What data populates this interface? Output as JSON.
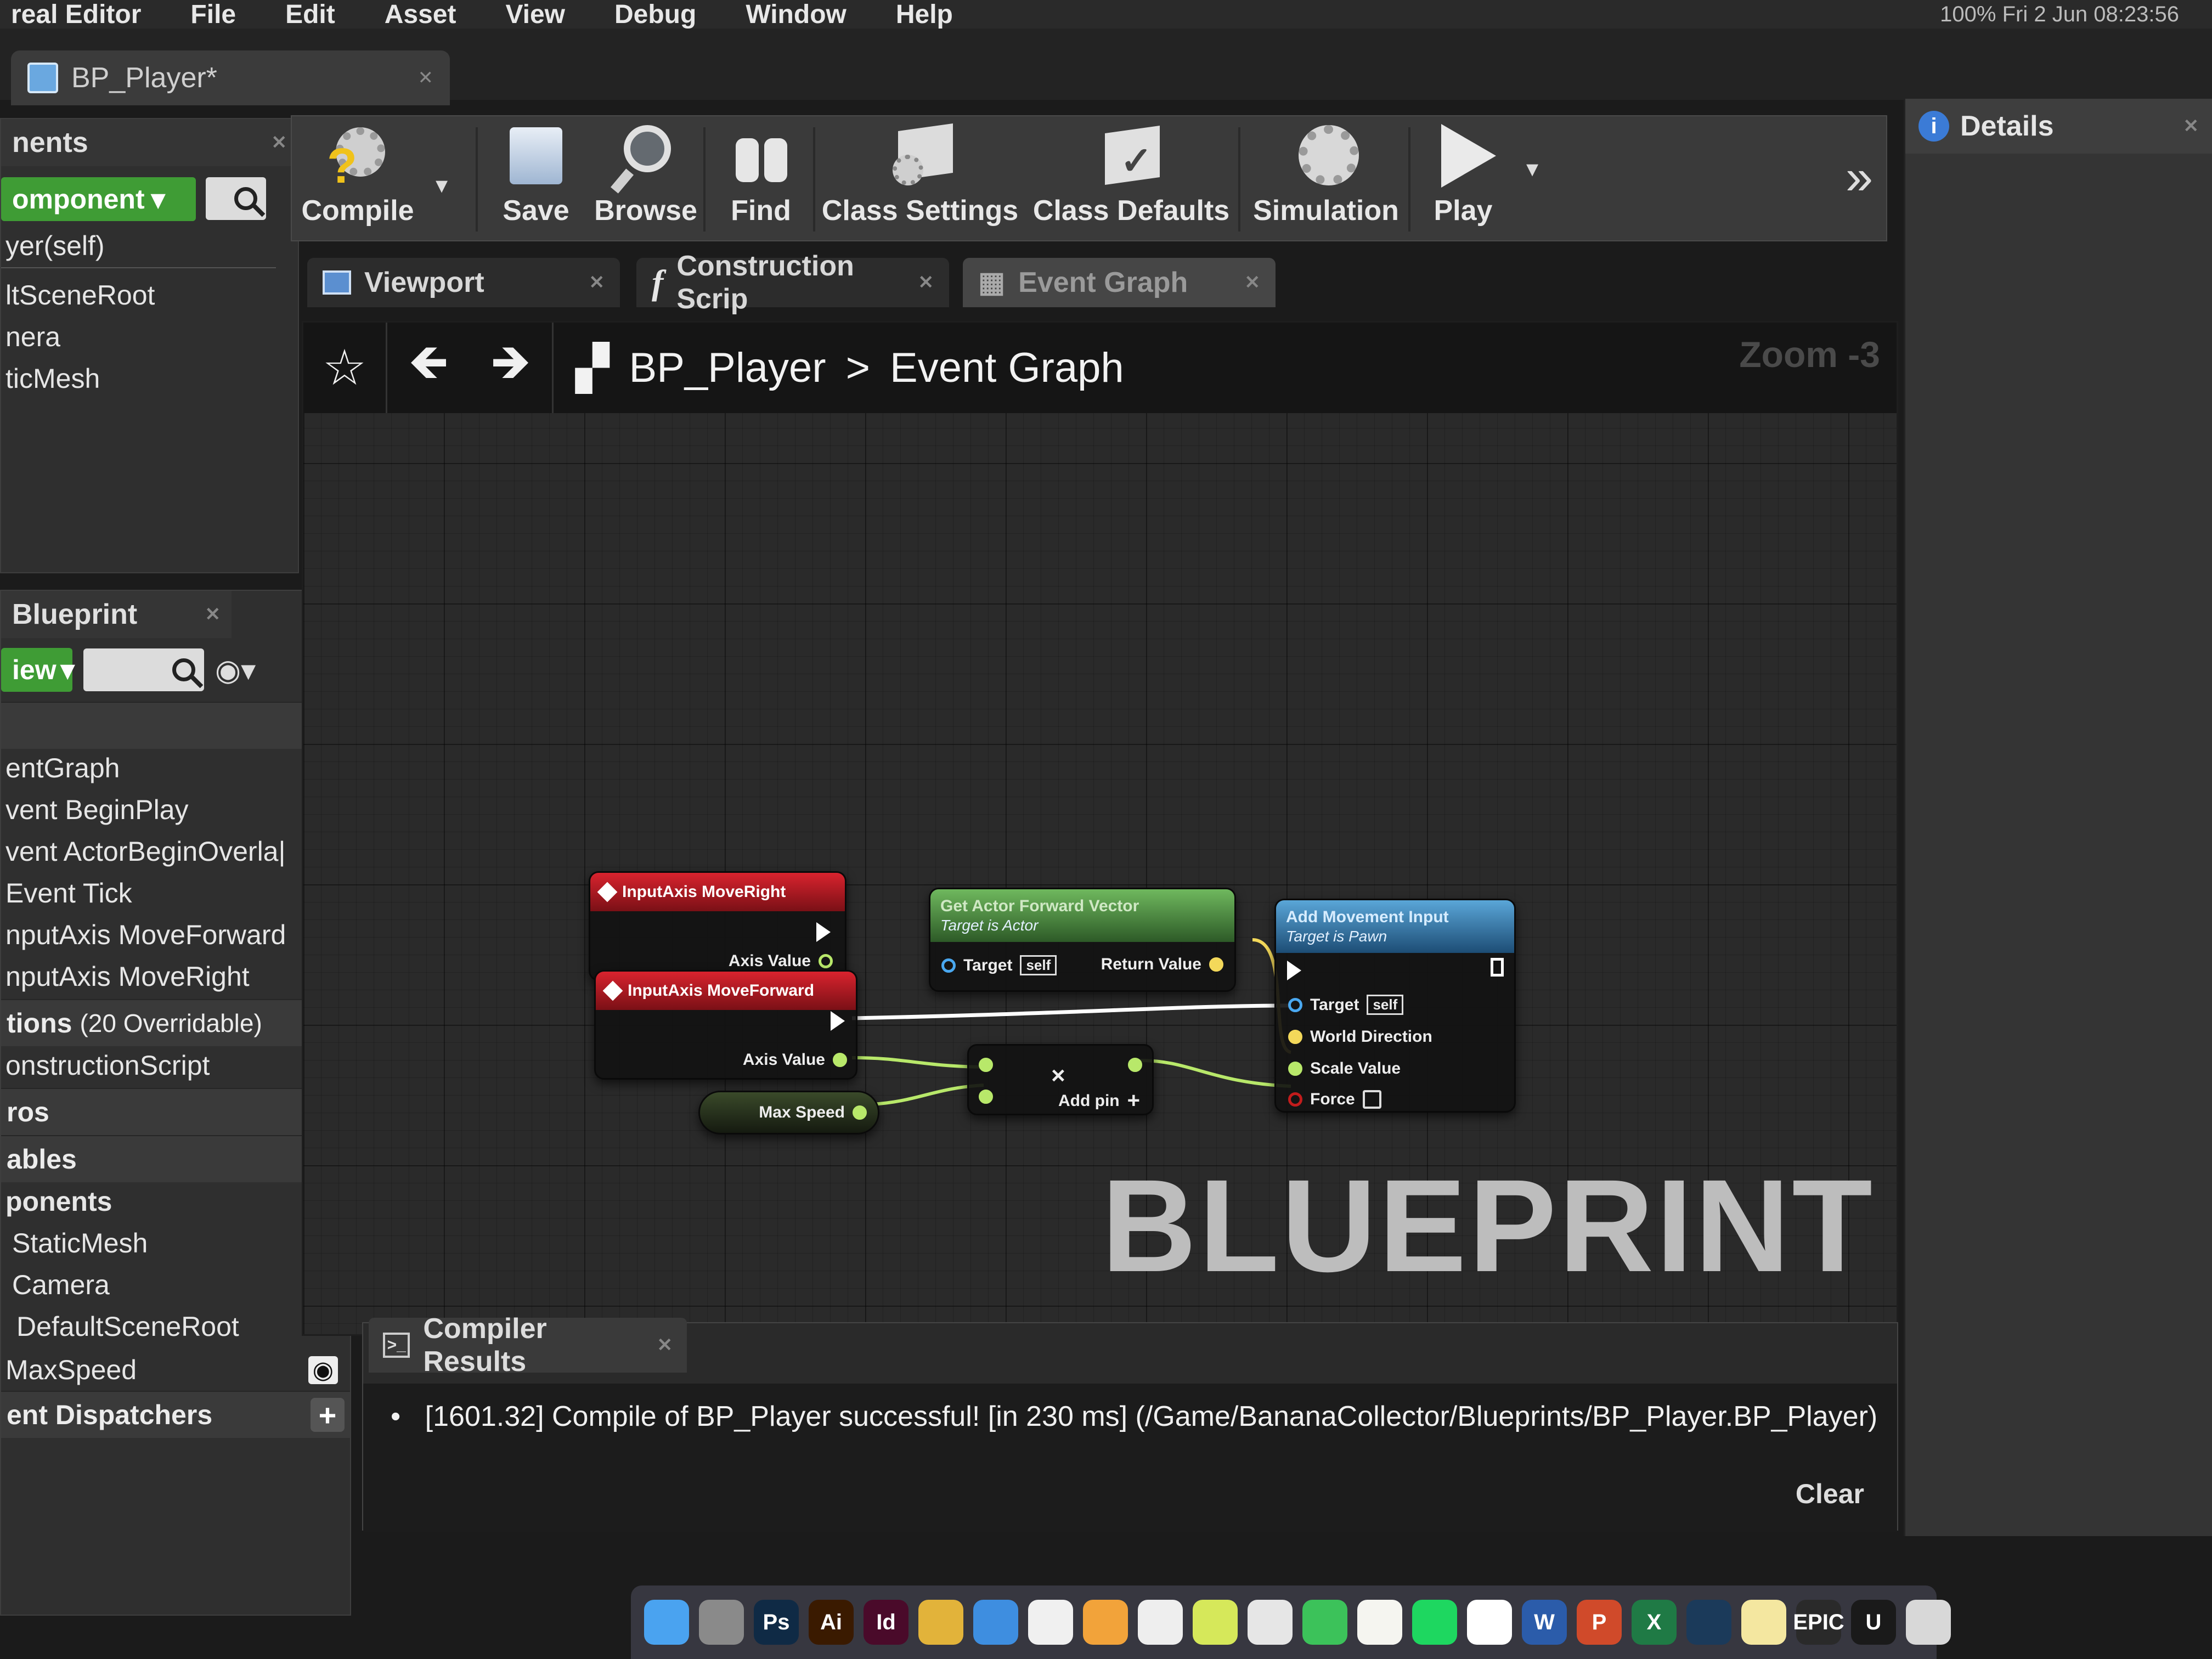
{
  "menu": {
    "items": [
      "real Editor",
      "File",
      "Edit",
      "Asset",
      "View",
      "Debug",
      "Window",
      "Help"
    ],
    "status": "100%   Fri 2 Jun 08:23:56"
  },
  "document_tab": {
    "label": "BP_Player*"
  },
  "components_panel": {
    "title": "nents",
    "add_button": "omponent",
    "items": [
      "yer(self)",
      "ltSceneRoot",
      "nera",
      "ticMesh"
    ]
  },
  "my_blueprint_panel": {
    "title": "Blueprint",
    "view_button": "iew",
    "graph_section": "",
    "graph_items": [
      "entGraph",
      "vent BeginPlay",
      "vent ActorBeginOverla|",
      "Event Tick",
      "nputAxis MoveForward",
      "nputAxis MoveRight"
    ],
    "functions_label": "tions",
    "functions_sub": "(20 Overridable)",
    "function_items": [
      "onstructionScript"
    ],
    "macros_label": "ros",
    "variables_label": "ables",
    "components_label": "ponents",
    "variable_items": [
      "StaticMesh",
      "Camera",
      "DefaultSceneRoot",
      "MaxSpeed"
    ],
    "dispatchers_label": "ent Dispatchers"
  },
  "toolbar": {
    "compile": "Compile",
    "save": "Save",
    "browse": "Browse",
    "find": "Find",
    "class_settings": "Class Settings",
    "class_defaults": "Class Defaults",
    "simulation": "Simulation",
    "play": "Play",
    "overflow": "»"
  },
  "graph_tabs": {
    "viewport": "Viewport",
    "construction": "Construction Scrip",
    "event_graph": "Event Graph"
  },
  "graph": {
    "breadcrumb_root": "BP_Player",
    "breadcrumb_separator": ">",
    "breadcrumb_current": "Event Graph",
    "zoom": "Zoom -3",
    "watermark": "BLUEPRINT"
  },
  "nodes": {
    "move_right": {
      "title": "InputAxis MoveRight",
      "out_pin": "Axis Value"
    },
    "move_forward": {
      "title": "InputAxis MoveForward",
      "out_pin": "Axis Value"
    },
    "max_speed": {
      "title": "Max Speed"
    },
    "get_forward": {
      "title": "Get Actor Forward Vector",
      "subtitle": "Target is Actor",
      "target_pin": "Target",
      "self_label": "self",
      "return_pin": "Return Value"
    },
    "multiply": {
      "symbol": "×",
      "add_pin": "Add pin"
    },
    "add_movement": {
      "title": "Add Movement Input",
      "subtitle": "Target is Pawn",
      "target_pin": "Target",
      "self_label": "self",
      "world_direction": "World Direction",
      "scale_value": "Scale Value",
      "force": "Force"
    }
  },
  "compiler_results": {
    "tab": "Compiler Results",
    "line": "[1601.32] Compile of BP_Player successful! [in 230 ms] (/Game/BananaCollector/Blueprints/BP_Player.BP_Player)",
    "clear": "Clear"
  },
  "details_panel": {
    "title": "Details"
  },
  "dock": {
    "apps": [
      {
        "name": "finder",
        "label": "",
        "color": "#4aa3f0"
      },
      {
        "name": "system-preferences",
        "label": "",
        "color": "#8a8a8a"
      },
      {
        "name": "photoshop",
        "label": "Ps",
        "color": "#0f2a45"
      },
      {
        "name": "illustrator",
        "label": "Ai",
        "color": "#3a1a00"
      },
      {
        "name": "indesign",
        "label": "Id",
        "color": "#4a0a2a"
      },
      {
        "name": "chrome",
        "label": "",
        "color": "#e2b33a"
      },
      {
        "name": "safari",
        "label": "",
        "color": "#3e8ee0"
      },
      {
        "name": "photos",
        "label": "",
        "color": "#f0f0f0"
      },
      {
        "name": "app-orange",
        "label": "",
        "color": "#f2a33a"
      },
      {
        "name": "app-b",
        "label": "",
        "color": "#eeeeee"
      },
      {
        "name": "app-green-circle",
        "label": "",
        "color": "#d6e85a"
      },
      {
        "name": "app-cloud",
        "label": "",
        "color": "#e6e6e6"
      },
      {
        "name": "whatsapp",
        "label": "",
        "color": "#3cc25a"
      },
      {
        "name": "notes",
        "label": "",
        "color": "#f5f5f0"
      },
      {
        "name": "spotify",
        "label": "",
        "color": "#1ed760"
      },
      {
        "name": "calendar",
        "label": "",
        "color": "#ffffff"
      },
      {
        "name": "word",
        "label": "W",
        "color": "#2b5caa"
      },
      {
        "name": "powerpoint",
        "label": "P",
        "color": "#d04a2a"
      },
      {
        "name": "excel",
        "label": "X",
        "color": "#1f7a45"
      },
      {
        "name": "steam",
        "label": "",
        "color": "#1b3a5a"
      },
      {
        "name": "stickies",
        "label": "",
        "color": "#f4e7a0"
      },
      {
        "name": "epic-games",
        "label": "EPIC",
        "color": "#2a2a2a"
      },
      {
        "name": "unreal-engine",
        "label": "U",
        "color": "#1a1a1a"
      },
      {
        "name": "trash",
        "label": "",
        "color": "#d8d8d8"
      }
    ]
  },
  "colors": {
    "exec_wire": "#ffffff",
    "float_wire": "#b8e86a",
    "vector_wire": "#f3d85a",
    "object_pin": "#4aa8f0",
    "bool_pin": "#c21c1c",
    "event_header": "#c8202a",
    "pure_header": "#5fa84e",
    "function_header": "#4a90c8"
  }
}
